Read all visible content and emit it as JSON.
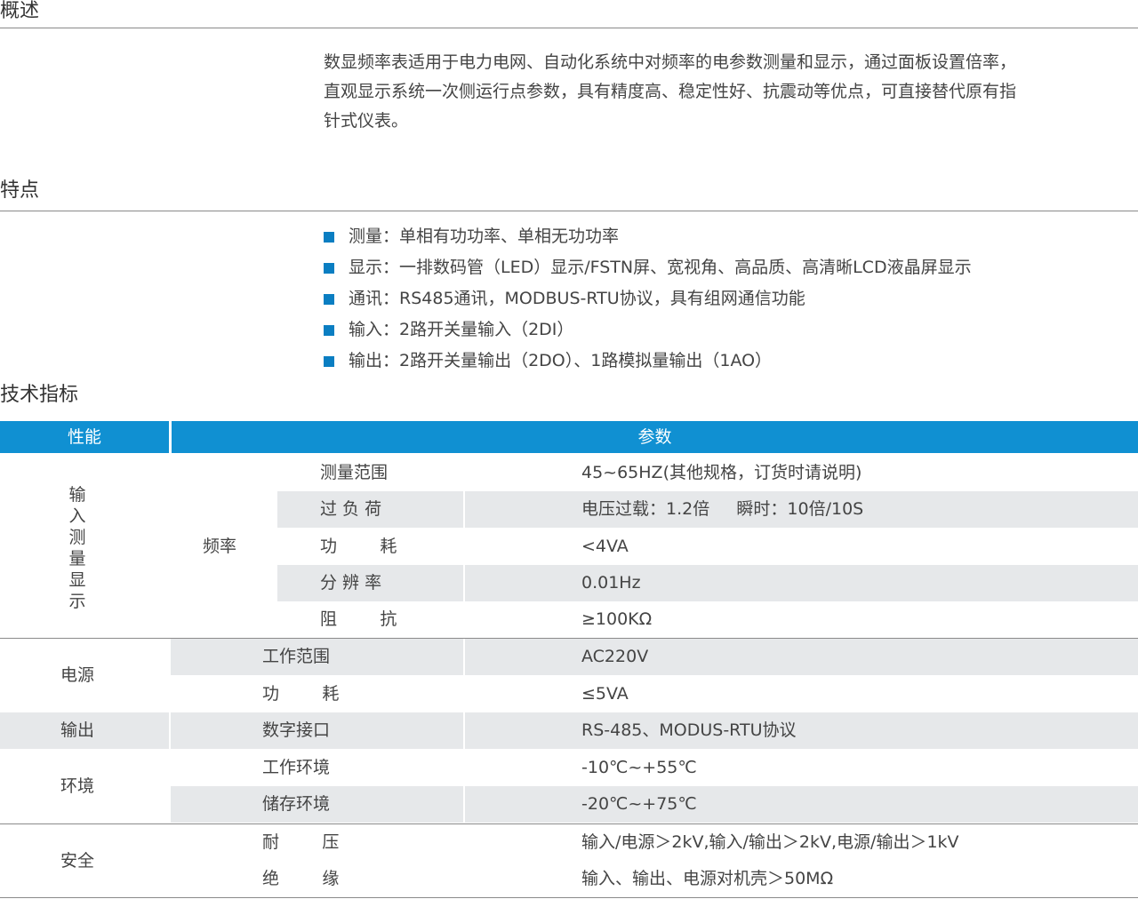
{
  "sections": {
    "overview_title": "概述",
    "features_title": "特点",
    "specs_title": "技术指标"
  },
  "overview": {
    "lines": [
      "数显频率表适用于电力电网、自动化系统中对频率的电参数测量和显示，通过面板设置倍率，",
      "直观显示系统一次侧运行点参数，具有精度高、稳定性好、抗震动等优点，可直接替代原有指",
      "针式仪表。"
    ]
  },
  "features": [
    "测量：单相有功功率、单相无功功率",
    "显示：一排数码管（LED）显示/FSTN屏、宽视角、高品质、高清晰LCD液晶屏显示",
    "通讯：RS485通讯，MODBUS-RTU协议，具有组网通信功能",
    "输入：2路开关量输入（2DI）",
    "输出：2路开关量输出（2DO）、1路模拟量输出（1AO）"
  ],
  "table": {
    "header": {
      "performance": "性能",
      "parameters": "参数"
    },
    "input_group": {
      "label_chars": [
        "输",
        "入",
        "测",
        "量",
        "显",
        "示"
      ],
      "sub_label": "频率",
      "rows": [
        {
          "name": "测量范围",
          "value": "45~65HZ(其他规格，订货时请说明)"
        },
        {
          "name": "过 负 荷",
          "value": "电压过载：1.2倍     瞬时：10倍/10S"
        },
        {
          "name": "功        耗",
          "value": "<4VA"
        },
        {
          "name": "分 辨 率",
          "value": "0.01Hz"
        },
        {
          "name": "阻        抗",
          "value": "≥100KΩ"
        }
      ]
    },
    "power": {
      "label": "电源",
      "rows": [
        {
          "name": "工作范围",
          "value": "AC220V"
        },
        {
          "name": "功        耗",
          "value": "≤5VA"
        }
      ]
    },
    "output": {
      "label": "输出",
      "rows": [
        {
          "name": "数字接口",
          "value": "RS-485、MODUS-RTU协议"
        }
      ]
    },
    "environment": {
      "label": "环境",
      "rows": [
        {
          "name": "工作环境",
          "value": "-10℃~+55℃"
        },
        {
          "name": "储存环境",
          "value": "-20℃~+75℃"
        }
      ]
    },
    "safety": {
      "label": "安全",
      "rows": [
        {
          "name": "耐        压",
          "value": "输入/电源＞2kV,输入/输出＞2kV,电源/输出＞1kV"
        },
        {
          "name": "绝        缘",
          "value": "输入、输出、电源对机壳＞50MΩ"
        }
      ]
    }
  },
  "colors": {
    "header_blue": "#1090d2",
    "bullet_blue": "#0a7ec2",
    "band_gray": "#e6e8ea"
  }
}
